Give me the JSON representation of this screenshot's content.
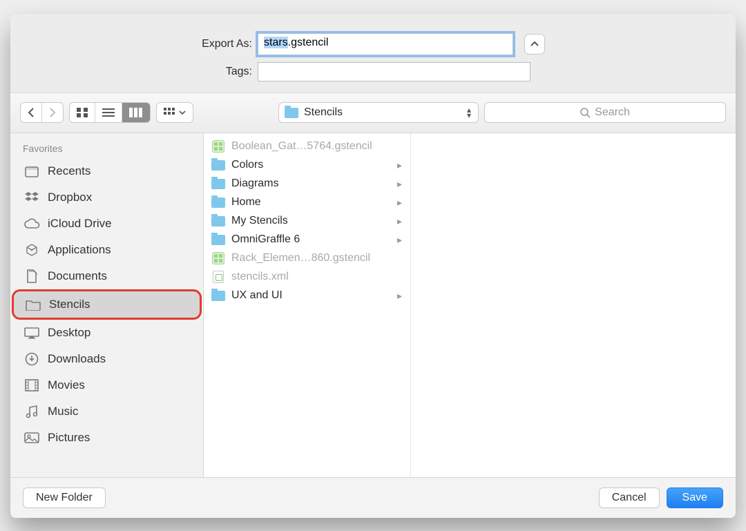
{
  "labels": {
    "export_as": "Export As:",
    "tags": "Tags:"
  },
  "filename": {
    "selected_part": "stars",
    "rest_part": ".gstencil"
  },
  "tags_value": "",
  "path": {
    "current": "Stencils"
  },
  "search": {
    "placeholder": "Search"
  },
  "sidebar_heading": "Favorites",
  "sidebar_items": [
    {
      "label": "Recents",
      "icon": "recents"
    },
    {
      "label": "Dropbox",
      "icon": "dropbox"
    },
    {
      "label": "iCloud Drive",
      "icon": "cloud"
    },
    {
      "label": "Applications",
      "icon": "applications"
    },
    {
      "label": "Documents",
      "icon": "documents"
    },
    {
      "label": "Stencils",
      "icon": "folder",
      "selected": true
    },
    {
      "label": "Desktop",
      "icon": "desktop"
    },
    {
      "label": "Downloads",
      "icon": "downloads"
    },
    {
      "label": "Movies",
      "icon": "movies"
    },
    {
      "label": "Music",
      "icon": "music"
    },
    {
      "label": "Pictures",
      "icon": "pictures"
    }
  ],
  "column_items": [
    {
      "label": "Boolean_Gat…5764.gstencil",
      "type": "gstencil",
      "dim": true
    },
    {
      "label": "Colors",
      "type": "folder"
    },
    {
      "label": "Diagrams",
      "type": "folder"
    },
    {
      "label": "Home",
      "type": "folder"
    },
    {
      "label": "My Stencils",
      "type": "folder"
    },
    {
      "label": "OmniGraffle 6",
      "type": "folder"
    },
    {
      "label": "Rack_Elemen…860.gstencil",
      "type": "gstencil",
      "dim": true
    },
    {
      "label": "stencils.xml",
      "type": "xml",
      "dim": true
    },
    {
      "label": "UX and UI",
      "type": "folder"
    }
  ],
  "buttons": {
    "new_folder": "New Folder",
    "cancel": "Cancel",
    "save": "Save"
  }
}
